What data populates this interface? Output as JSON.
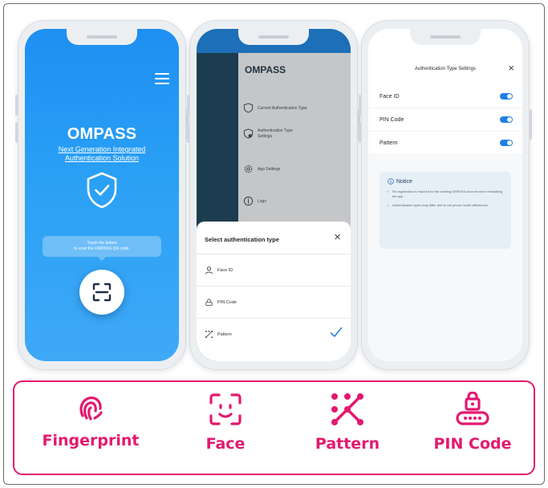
{
  "phone1": {
    "brand": "OMPASS",
    "tagline_line1": "Next Generation Integrated",
    "tagline_line2": "Authentication Solution",
    "bubble_line1": "Touch the button",
    "bubble_line2": "to scan the OMPASS QR code."
  },
  "phone2": {
    "brand": "OMPASS",
    "menu": [
      {
        "label": "Current Authentication Type",
        "icon": "shield-icon"
      },
      {
        "label": "Authentication Type Settings",
        "icon": "shield-gear-icon"
      },
      {
        "label": "App Settings",
        "icon": "gear-icon"
      },
      {
        "label": "Logs",
        "icon": "info-icon"
      }
    ],
    "sheet": {
      "title": "Select authentication type",
      "options": [
        {
          "label": "Face ID",
          "icon": "person-icon",
          "selected": false
        },
        {
          "label": "PIN Code",
          "icon": "keypad-icon",
          "selected": false
        },
        {
          "label": "Pattern",
          "icon": "pattern-icon",
          "selected": true
        }
      ]
    }
  },
  "phone3": {
    "title": "Authentication Type Settings",
    "toggles": [
      {
        "label": "Face ID",
        "on": true
      },
      {
        "label": "PIN Code",
        "on": true
      },
      {
        "label": "Pattern",
        "on": true
      }
    ],
    "notice": {
      "heading": "Notice",
      "items": [
        "Re-registration is required for the existing OMPASS account when reinstalling the app",
        "Authentication types may differ due to cell phone model differences"
      ]
    }
  },
  "features": [
    {
      "label": "Fingerprint",
      "icon": "fingerprint-icon"
    },
    {
      "label": "Face",
      "icon": "face-scan-icon"
    },
    {
      "label": "Pattern",
      "icon": "pattern-icon"
    },
    {
      "label": "PIN Code",
      "icon": "lock-keypad-icon"
    }
  ],
  "colors": {
    "accent": "#e3196f",
    "primary_blue": "#1e8ff2",
    "toggle_blue": "#1f7fe6"
  }
}
